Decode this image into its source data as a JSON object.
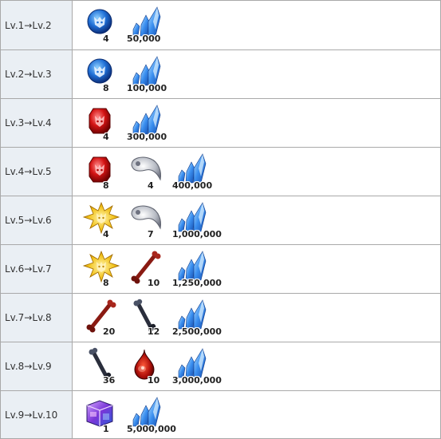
{
  "rows": [
    {
      "label": "Lv.1→Lv.2",
      "items": [
        {
          "icon": "blue-orb-icon",
          "qty": "4"
        },
        {
          "icon": "crystal-icon",
          "qty": "50,000"
        }
      ]
    },
    {
      "label": "Lv.2→Lv.3",
      "items": [
        {
          "icon": "blue-orb-icon",
          "qty": "8"
        },
        {
          "icon": "crystal-icon",
          "qty": "100,000"
        }
      ]
    },
    {
      "label": "Lv.3→Lv.4",
      "items": [
        {
          "icon": "red-gem-icon",
          "qty": "4"
        },
        {
          "icon": "crystal-icon",
          "qty": "300,000"
        }
      ]
    },
    {
      "label": "Lv.4→Lv.5",
      "items": [
        {
          "icon": "red-gem-icon",
          "qty": "8"
        },
        {
          "icon": "silver-horn-icon",
          "qty": "4"
        },
        {
          "icon": "crystal-icon",
          "qty": "400,000"
        }
      ]
    },
    {
      "label": "Lv.5→Lv.6",
      "items": [
        {
          "icon": "gold-star-icon",
          "qty": "4"
        },
        {
          "icon": "silver-horn-icon",
          "qty": "7"
        },
        {
          "icon": "crystal-icon",
          "qty": "1,000,000"
        }
      ]
    },
    {
      "label": "Lv.6→Lv.7",
      "items": [
        {
          "icon": "gold-star-icon",
          "qty": "8"
        },
        {
          "icon": "red-bone-icon",
          "qty": "10"
        },
        {
          "icon": "crystal-icon",
          "qty": "1,250,000"
        }
      ]
    },
    {
      "label": "Lv.7→Lv.8",
      "items": [
        {
          "icon": "red-bone-icon",
          "qty": "20"
        },
        {
          "icon": "dark-bone-icon",
          "qty": "12"
        },
        {
          "icon": "crystal-icon",
          "qty": "2,500,000"
        }
      ]
    },
    {
      "label": "Lv.8→Lv.9",
      "items": [
        {
          "icon": "dark-bone-icon",
          "qty": "36"
        },
        {
          "icon": "blood-drop-icon",
          "qty": "10"
        },
        {
          "icon": "crystal-icon",
          "qty": "3,000,000"
        }
      ]
    },
    {
      "label": "Lv.9→Lv.10",
      "items": [
        {
          "icon": "purple-cube-icon",
          "qty": "1"
        },
        {
          "icon": "crystal-icon",
          "qty": "5,000,000"
        }
      ]
    }
  ]
}
